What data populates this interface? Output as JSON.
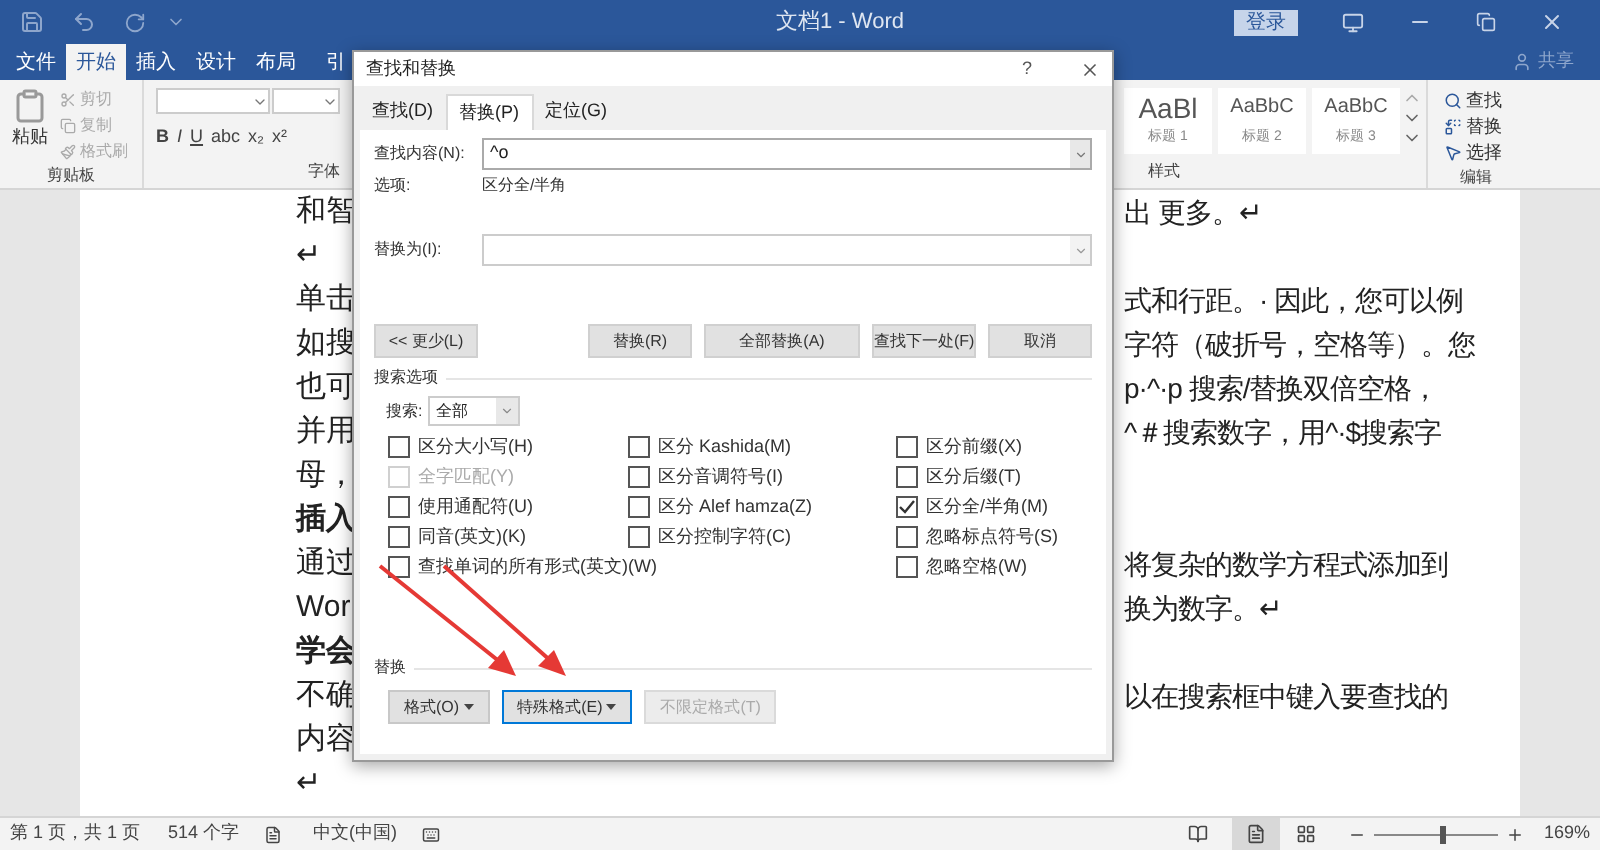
{
  "title_bar": {
    "title": "文档1 - Word",
    "sign_in": "登录"
  },
  "ribbon_tabs": [
    {
      "label": "文件",
      "selected": false
    },
    {
      "label": "开始",
      "selected": true
    },
    {
      "label": "插入",
      "selected": false
    },
    {
      "label": "设计",
      "selected": false
    },
    {
      "label": "布局",
      "selected": false
    },
    {
      "label": "引",
      "selected": false
    }
  ],
  "share": "共享",
  "ribbon": {
    "clipboard": {
      "paste": "粘贴",
      "items": [
        {
          "label": "剪切",
          "disabled": true
        },
        {
          "label": "复制",
          "disabled": true
        },
        {
          "label": "格式刷",
          "disabled": true
        }
      ],
      "label": "剪贴板"
    },
    "font": {
      "format_buttons": [
        "B",
        "I",
        "U",
        "abc",
        "x₂",
        "x²"
      ],
      "label": "字体"
    },
    "styles": {
      "items": [
        {
          "preview": "AaBl",
          "name": "标题 1"
        },
        {
          "preview": "AaBbC",
          "name": "标题 2"
        },
        {
          "preview": "AaBbC",
          "name": "标题 3"
        }
      ],
      "label": "样式"
    },
    "editing": {
      "items": [
        "查找",
        "替换",
        "选择"
      ],
      "label": "编辑"
    }
  },
  "document": {
    "lines": [
      {
        "left": "和智",
        "right": "出 更多。↵",
        "bold": false
      },
      {
        "left": "↵",
        "bold": false
      },
      {
        "left": "单击",
        "right": "式和行距。· 因此，您可以例",
        "bold": false
      },
      {
        "left": "如搜",
        "right": "字符（破折号，空格等）。您",
        "bold": false
      },
      {
        "left": "也可",
        "right": "p·^·p 搜索/替换双倍空格，",
        "bold": false
      },
      {
        "left": "并用",
        "right": "^＃搜索数字，用^·$搜索字",
        "bold": false
      },
      {
        "left": "母，",
        "bold": false
      },
      {
        "left": "插入",
        "bold": true
      },
      {
        "left": "通过",
        "right": "将复杂的数学方程式添加到",
        "bold": false
      },
      {
        "left": "Wor",
        "right": "换为数字。↵",
        "bold": false
      },
      {
        "left": "学会",
        "bold": true
      },
      {
        "left": "不确",
        "right": "以在搜索框中键入要查找的",
        "bold": false
      },
      {
        "left": "内容",
        "bold": false
      },
      {
        "left": "↵",
        "bold": false
      }
    ]
  },
  "dialog": {
    "title": "查找和替换",
    "help": "?",
    "tabs": [
      {
        "label": "查找(D)",
        "selected": false
      },
      {
        "label": "替换(P)",
        "selected": true
      },
      {
        "label": "定位(G)",
        "selected": false
      }
    ],
    "find": {
      "label": "查找内容(N):",
      "value": "^o"
    },
    "options": {
      "label": "选项:",
      "value": "区分全/半角"
    },
    "replace": {
      "label": "替换为(I):"
    },
    "buttons": [
      {
        "label": "<< 更少(L)"
      },
      {
        "label": "替换(R)"
      },
      {
        "label": "全部替换(A)"
      },
      {
        "label": "查找下一处(F)"
      },
      {
        "label": "取消"
      }
    ],
    "search_options": {
      "title": "搜索选项",
      "search_label": "搜索:",
      "search_value": "全部",
      "columns": [
        [
          {
            "label": "区分大小写(H)",
            "checked": false,
            "disabled": false
          },
          {
            "label": "全字匹配(Y)",
            "checked": false,
            "disabled": true
          },
          {
            "label": "使用通配符(U)",
            "checked": false,
            "disabled": false
          },
          {
            "label": "同音(英文)(K)",
            "checked": false,
            "disabled": false
          },
          {
            "label": "查找单词的所有形式(英文)(W)",
            "checked": false,
            "disabled": false
          }
        ],
        [
          {
            "label": "区分 Kashida(M)",
            "checked": false,
            "disabled": false
          },
          {
            "label": "区分音调符号(I)",
            "checked": false,
            "disabled": false
          },
          {
            "label": "区分 Alef hamza(Z)",
            "checked": false,
            "disabled": false
          },
          {
            "label": "区分控制字符(C)",
            "checked": false,
            "disabled": false
          }
        ],
        [
          {
            "label": "区分前缀(X)",
            "checked": false,
            "disabled": false
          },
          {
            "label": "区分后缀(T)",
            "checked": false,
            "disabled": false
          },
          {
            "label": "区分全/半角(M)",
            "checked": true,
            "disabled": false
          },
          {
            "label": "忽略标点符号(S)",
            "checked": false,
            "disabled": false
          },
          {
            "label": "忽略空格(W)",
            "checked": false,
            "disabled": false
          }
        ]
      ]
    },
    "replace_section": {
      "title": "替换",
      "buttons": [
        {
          "label": "格式(O)",
          "dropdown": true,
          "focused": false,
          "disabled": false
        },
        {
          "label": "特殊格式(E)",
          "dropdown": true,
          "focused": true,
          "disabled": false
        },
        {
          "label": "不限定格式(T)",
          "dropdown": false,
          "focused": false,
          "disabled": true
        }
      ]
    }
  },
  "status_bar": {
    "page": "第 1 页，共 1 页",
    "words": "514 个字",
    "language": "中文(中国)",
    "zoom": {
      "level": 0.56
    },
    "zoom_percent": "169%"
  }
}
